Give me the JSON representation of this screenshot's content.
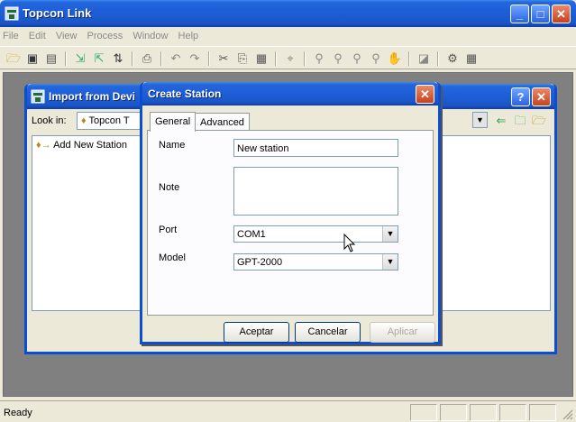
{
  "app": {
    "title": "Topcon Link",
    "buttons": {
      "minimize": "_",
      "maximize": "□",
      "close": "✕"
    }
  },
  "menu": [
    "File",
    "Edit",
    "View",
    "Process",
    "Window",
    "Help"
  ],
  "toolbar_icons": [
    "open-folder-icon",
    "save-icon",
    "properties-icon",
    "import-icon",
    "export-icon",
    "process-icon",
    "print-icon",
    "undo-icon",
    "redo-icon",
    "cut-icon",
    "copy-icon",
    "paste-icon",
    "pointer-icon",
    "zoom-in-icon",
    "zoom-out-icon",
    "zoom-all-icon",
    "zoom-window-icon",
    "pan-hand-icon",
    "map-view-icon",
    "settings-icon",
    "grid-icon"
  ],
  "import_window": {
    "title": "Import from Devi",
    "help_button": "?",
    "close_button": "✕",
    "look_in_label": "Look in:",
    "look_in_value": "Topcon T",
    "list_items": [
      "Add New Station"
    ]
  },
  "dialog": {
    "title": "Create Station",
    "close_button": "✕",
    "tabs": [
      "General",
      "Advanced"
    ],
    "fields": {
      "name_label": "Name",
      "name_value": "New station",
      "note_label": "Note",
      "note_value": "",
      "port_label": "Port",
      "port_value": "COM1",
      "model_label": "Model",
      "model_value": "GPT-2000"
    },
    "buttons": {
      "ok": "Aceptar",
      "cancel": "Cancelar",
      "apply": "Aplicar"
    }
  },
  "status": {
    "text": "Ready"
  }
}
